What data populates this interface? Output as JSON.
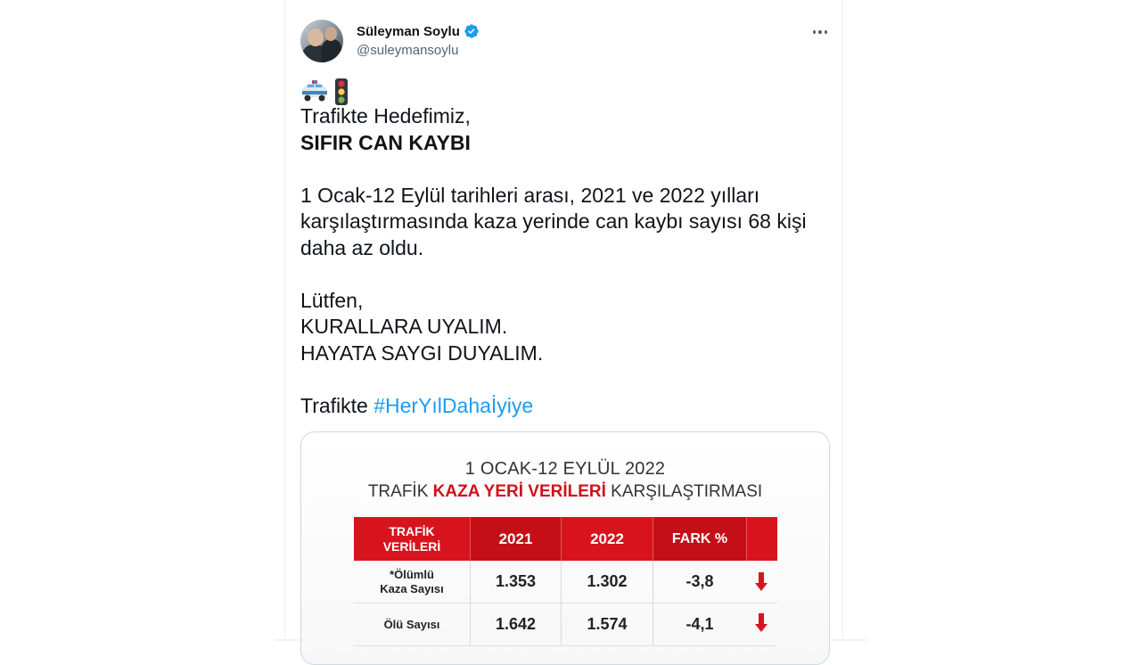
{
  "author": {
    "display_name": "Süleyman Soylu",
    "handle": "@suleymansoylu",
    "verified": true
  },
  "tweet": {
    "emojis": [
      "police-car-emoji",
      "traffic-light-emoji"
    ],
    "line1": "Trafikte Hedefimiz,",
    "line2": "SIFIR CAN KAYBI",
    "para2_l1": "1 Ocak-12 Eylül tarihleri arası, 2021 ve 2022 yılları",
    "para2_l2": "karşılaştırmasında kaza yerinde can kaybı sayısı 68 kişi",
    "para2_l3": "daha az oldu.",
    "para3_l1": "Lütfen,",
    "para3_l2": "KURALLARA UYALIM.",
    "para3_l3": "HAYATA SAYGI DUYALIM.",
    "last_prefix": "Trafikte ",
    "hashtag": "#HerYılDahaİyiye"
  },
  "media": {
    "title_line1": "1 OCAK-12 EYLÜL 2022",
    "title_line2_pre": "TRAFİK ",
    "title_line2_red": "KAZA YERİ VERİLERİ",
    "title_line2_post": " KARŞILAŞTIRMASI",
    "table": {
      "header_label_l1": "TRAFİK",
      "header_label_l2": "VERİLERİ",
      "col_2021": "2021",
      "col_2022": "2022",
      "col_fark": "FARK %",
      "rows": [
        {
          "label_l1": "*Ölümlü",
          "label_l2": "Kaza Sayısı",
          "v2021": "1.353",
          "v2022": "1.302",
          "fark": "-3,8",
          "trend": "down"
        },
        {
          "label_l1": "Ölü Sayısı",
          "label_l2": "",
          "v2021": "1.642",
          "v2022": "1.574",
          "fark": "-4,1",
          "trend": "down"
        }
      ]
    }
  },
  "colors": {
    "accent_blue": "#1d9bf0",
    "table_red": "#d7141d",
    "text_primary": "#0f1419",
    "text_secondary": "#536471"
  }
}
